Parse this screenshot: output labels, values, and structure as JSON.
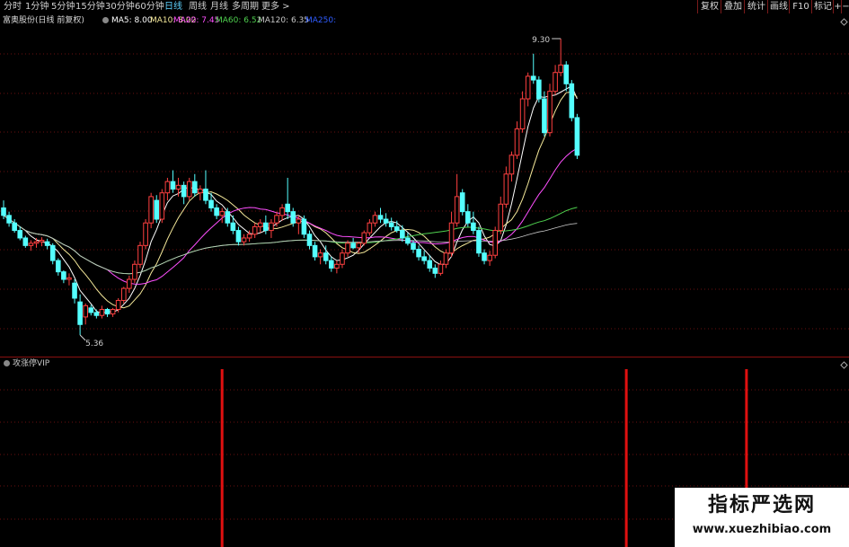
{
  "toolbar": {
    "periods": [
      "分时",
      "1分钟",
      "5分钟",
      "15分钟",
      "30分钟",
      "60分钟",
      "日线",
      "周线",
      "月线",
      "多周期",
      "更多 >"
    ],
    "active_period": "日线",
    "right_buttons": [
      "复权",
      "叠加",
      "统计",
      "画线",
      "F10",
      "标记",
      "+",
      "−"
    ]
  },
  "header": {
    "title": "富奥股份(日线 前复权)",
    "ma": [
      {
        "label": "MA5: 8.00",
        "color": "#ffffff"
      },
      {
        "label": "MA10: 8.02",
        "color": "#f5e99a"
      },
      {
        "label": "MA20: 7.45",
        "color": "#ff4fff"
      },
      {
        "label": "MA60: 6.52",
        "color": "#4fd14f"
      },
      {
        "label": "MA120: 6.35",
        "color": "#c8c8c8"
      },
      {
        "label": "MA250:",
        "color": "#2f5cff"
      }
    ]
  },
  "price_chart": {
    "high_label": "9.30",
    "low_label": "5.36"
  },
  "indicator": {
    "name": "攻涨停VIP",
    "signals": [
      {
        "candle_index": 40
      },
      {
        "candle_index": 114
      },
      {
        "candle_index": 136
      }
    ]
  },
  "watermark": {
    "line1": "指标严选网",
    "line2": "www.xuezhibiao.com"
  },
  "colors": {
    "up": "#ff4040",
    "down": "#54ffff",
    "signal": "#e01010",
    "grid": "#6a1010",
    "ma5": "#ffffff",
    "ma10": "#f5e99a",
    "ma20": "#ff4fff",
    "ma60": "#4fd14f",
    "ma120": "#c8c8c8"
  },
  "chart_data": {
    "type": "candlestick",
    "ohlc": [
      [
        7.05,
        7.15,
        6.9,
        6.95
      ],
      [
        6.95,
        7.0,
        6.8,
        6.85
      ],
      [
        6.85,
        6.9,
        6.72,
        6.75
      ],
      [
        6.75,
        6.8,
        6.62,
        6.65
      ],
      [
        6.65,
        6.68,
        6.52,
        6.55
      ],
      [
        6.55,
        6.62,
        6.48,
        6.58
      ],
      [
        6.58,
        6.65,
        6.52,
        6.6
      ],
      [
        6.6,
        6.66,
        6.54,
        6.62
      ],
      [
        6.6,
        6.64,
        6.5,
        6.55
      ],
      [
        6.55,
        6.58,
        6.3,
        6.35
      ],
      [
        6.35,
        6.38,
        6.15,
        6.2
      ],
      [
        6.2,
        6.22,
        6.05,
        6.1
      ],
      [
        6.1,
        6.18,
        6.02,
        6.12
      ],
      [
        6.05,
        6.1,
        5.78,
        5.85
      ],
      [
        5.8,
        5.9,
        5.36,
        5.5
      ],
      [
        5.6,
        5.78,
        5.5,
        5.75
      ],
      [
        5.72,
        5.76,
        5.62,
        5.66
      ],
      [
        5.66,
        5.7,
        5.58,
        5.62
      ],
      [
        5.62,
        5.75,
        5.58,
        5.7
      ],
      [
        5.7,
        5.72,
        5.6,
        5.64
      ],
      [
        5.64,
        5.72,
        5.6,
        5.7
      ],
      [
        5.7,
        5.85,
        5.66,
        5.82
      ],
      [
        5.82,
        6.0,
        5.78,
        5.98
      ],
      [
        5.98,
        6.15,
        5.92,
        6.1
      ],
      [
        6.1,
        6.35,
        6.05,
        6.3
      ],
      [
        6.3,
        6.6,
        6.25,
        6.55
      ],
      [
        6.55,
        6.9,
        6.5,
        6.85
      ],
      [
        6.85,
        7.25,
        6.78,
        7.2
      ],
      [
        7.15,
        7.22,
        6.85,
        6.9
      ],
      [
        6.9,
        7.3,
        6.85,
        7.25
      ],
      [
        7.25,
        7.45,
        7.15,
        7.4
      ],
      [
        7.4,
        7.55,
        7.25,
        7.3
      ],
      [
        7.3,
        7.45,
        7.2,
        7.35
      ],
      [
        7.35,
        7.4,
        7.1,
        7.2
      ],
      [
        7.2,
        7.45,
        7.15,
        7.4
      ],
      [
        7.4,
        7.5,
        7.2,
        7.25
      ],
      [
        7.25,
        7.35,
        7.15,
        7.3
      ],
      [
        7.3,
        7.55,
        7.1,
        7.15
      ],
      [
        7.15,
        7.25,
        7.0,
        7.05
      ],
      [
        7.05,
        7.1,
        6.9,
        6.95
      ],
      [
        6.95,
        7.05,
        6.85,
        7.0
      ],
      [
        7.0,
        7.05,
        6.8,
        6.85
      ],
      [
        6.85,
        6.95,
        6.7,
        6.75
      ],
      [
        6.75,
        6.8,
        6.55,
        6.6
      ],
      [
        6.6,
        6.7,
        6.55,
        6.65
      ],
      [
        6.65,
        6.75,
        6.6,
        6.7
      ],
      [
        6.7,
        6.85,
        6.65,
        6.8
      ],
      [
        6.8,
        6.9,
        6.72,
        6.85
      ],
      [
        6.85,
        6.95,
        6.7,
        6.75
      ],
      [
        6.75,
        6.9,
        6.65,
        6.85
      ],
      [
        6.85,
        7.0,
        6.8,
        6.95
      ],
      [
        6.95,
        7.1,
        6.88,
        7.05
      ],
      [
        7.1,
        7.45,
        6.9,
        7.0
      ],
      [
        7.0,
        7.05,
        6.8,
        6.85
      ],
      [
        6.85,
        6.95,
        6.7,
        6.9
      ],
      [
        6.9,
        6.95,
        6.65,
        6.7
      ],
      [
        6.7,
        6.75,
        6.5,
        6.55
      ],
      [
        6.55,
        6.6,
        6.35,
        6.4
      ],
      [
        6.4,
        6.5,
        6.3,
        6.45
      ],
      [
        6.45,
        6.55,
        6.3,
        6.35
      ],
      [
        6.35,
        6.4,
        6.2,
        6.25
      ],
      [
        6.25,
        6.35,
        6.18,
        6.3
      ],
      [
        6.3,
        6.5,
        6.25,
        6.45
      ],
      [
        6.45,
        6.62,
        6.4,
        6.58
      ],
      [
        6.58,
        6.65,
        6.5,
        6.52
      ],
      [
        6.52,
        6.6,
        6.45,
        6.58
      ],
      [
        6.58,
        6.75,
        6.55,
        6.72
      ],
      [
        6.72,
        6.9,
        6.68,
        6.85
      ],
      [
        6.85,
        7.0,
        6.8,
        6.95
      ],
      [
        6.95,
        7.05,
        6.85,
        6.9
      ],
      [
        6.9,
        6.98,
        6.8,
        6.85
      ],
      [
        6.85,
        6.92,
        6.75,
        6.8
      ],
      [
        6.8,
        6.88,
        6.72,
        6.75
      ],
      [
        6.75,
        6.82,
        6.6,
        6.65
      ],
      [
        6.65,
        6.72,
        6.55,
        6.58
      ],
      [
        6.58,
        6.62,
        6.45,
        6.5
      ],
      [
        6.5,
        6.55,
        6.35,
        6.4
      ],
      [
        6.4,
        6.48,
        6.3,
        6.35
      ],
      [
        6.35,
        6.42,
        6.2,
        6.25
      ],
      [
        6.25,
        6.3,
        6.12,
        6.18
      ],
      [
        6.18,
        6.35,
        6.15,
        6.3
      ],
      [
        6.3,
        6.5,
        6.25,
        6.45
      ],
      [
        6.45,
        7.0,
        6.4,
        6.85
      ],
      [
        6.85,
        7.5,
        6.8,
        7.2
      ],
      [
        7.25,
        7.3,
        6.95,
        7.0
      ],
      [
        7.0,
        7.1,
        6.8,
        6.85
      ],
      [
        6.85,
        7.0,
        6.7,
        6.75
      ],
      [
        6.75,
        6.8,
        6.4,
        6.45
      ],
      [
        6.45,
        6.5,
        6.3,
        6.35
      ],
      [
        6.35,
        6.48,
        6.28,
        6.42
      ],
      [
        6.42,
        6.8,
        6.38,
        6.75
      ],
      [
        6.75,
        7.2,
        6.7,
        7.1
      ],
      [
        7.1,
        7.6,
        7.05,
        7.5
      ],
      [
        7.5,
        7.8,
        7.4,
        7.75
      ],
      [
        7.75,
        8.2,
        7.7,
        8.1
      ],
      [
        8.1,
        8.6,
        8.05,
        8.5
      ],
      [
        8.5,
        8.85,
        8.4,
        8.8
      ],
      [
        8.8,
        9.1,
        8.7,
        8.75
      ],
      [
        8.75,
        8.8,
        8.45,
        8.5
      ],
      [
        8.5,
        8.6,
        8.0,
        8.05
      ],
      [
        8.05,
        8.7,
        8.0,
        8.6
      ],
      [
        8.6,
        8.95,
        8.55,
        8.85
      ],
      [
        8.85,
        9.3,
        8.8,
        8.95
      ],
      [
        8.95,
        9.0,
        8.6,
        8.7
      ],
      [
        8.7,
        8.75,
        8.2,
        8.25
      ],
      [
        8.25,
        8.3,
        7.7,
        7.75
      ]
    ],
    "low_price": 5.36,
    "high_price": 9.3
  }
}
